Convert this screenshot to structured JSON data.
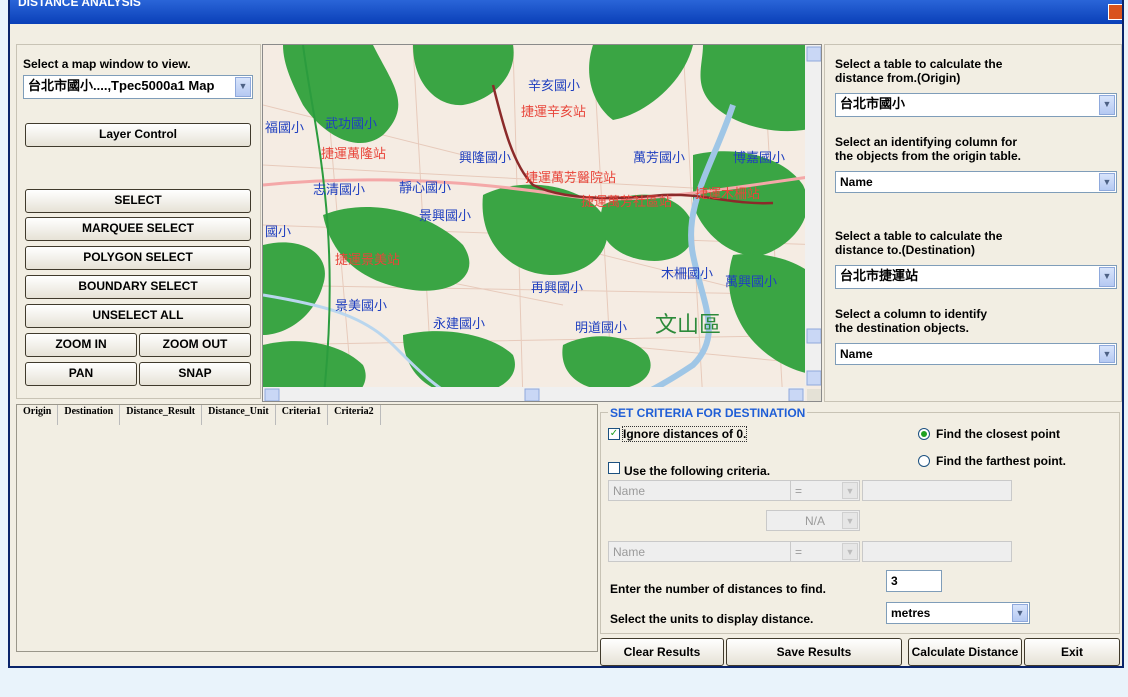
{
  "window": {
    "title": "DISTANCE ANALYSIS"
  },
  "left": {
    "map_window_label": "Select a map window to view.",
    "map_window_value": "台北市國小....,Tpec5000a1 Map",
    "layer_control": "Layer Control",
    "select": "SELECT",
    "marquee_select": "MARQUEE SELECT",
    "polygon_select": "POLYGON SELECT",
    "boundary_select": "BOUNDARY SELECT",
    "unselect_all": "UNSELECT ALL",
    "zoom_in": "ZOOM IN",
    "zoom_out": "ZOOM OUT",
    "pan": "PAN",
    "snap": "SNAP"
  },
  "map": {
    "schools": [
      "辛亥國小",
      "武功國小",
      "興隆國小",
      "萬芳國小",
      "博嘉國小",
      "志清國小",
      "靜心國小",
      "景興國小",
      "木柵國小",
      "萬興國小",
      "景美國小",
      "再興國小",
      "永建國小",
      "明道國小"
    ],
    "district": "文山區",
    "fragments": [
      "福國小",
      "國小"
    ],
    "stations": [
      "捷運辛亥站",
      "捷運萬隆站",
      "捷運萬芳醫院站",
      "捷運萬芳社區站",
      "捷運木柵站",
      "捷運景美站"
    ]
  },
  "right": {
    "origin_table_label_1": "Select a table to calculate the",
    "origin_table_label_2": "distance from.(Origin)",
    "origin_table_value": "台北市國小",
    "origin_col_label_1": "Select an identifying column for",
    "origin_col_label_2": "the objects from the origin table.",
    "origin_col_value": "Name",
    "dest_table_label_1": "Select a table to calculate the",
    "dest_table_label_2": "distance to.(Destination)",
    "dest_table_value": "台北市捷運站",
    "dest_col_label_1": "Select a column to identify",
    "dest_col_label_2": "the destination objects.",
    "dest_col_value": "Name"
  },
  "results": {
    "columns": [
      "Origin",
      "Destination",
      "Distance_Result",
      "Distance_Unit",
      "Criteria1",
      "Criteria2"
    ]
  },
  "criteria": {
    "title": "SET CRITERIA FOR DESTINATION",
    "ignore_zero": "Ignore distances of 0.",
    "ignore_zero_checked": true,
    "find_closest": "Find the closest point",
    "find_farthest": "Find the farthest point.",
    "closest_selected": true,
    "use_criteria": "Use the following criteria.",
    "use_criteria_checked": false,
    "crit1_field": "Name",
    "crit1_op": "=",
    "logic": "N/A",
    "crit2_field": "Name",
    "crit2_op": "=",
    "num_label": "Enter the number of distances to find.",
    "num_value": "3",
    "units_label": "Select the units to display distance.",
    "units_value": "metres"
  },
  "footer": {
    "clear": "Clear Results",
    "save": "Save Results",
    "calculate": "Calculate Distance",
    "exit": "Exit"
  }
}
